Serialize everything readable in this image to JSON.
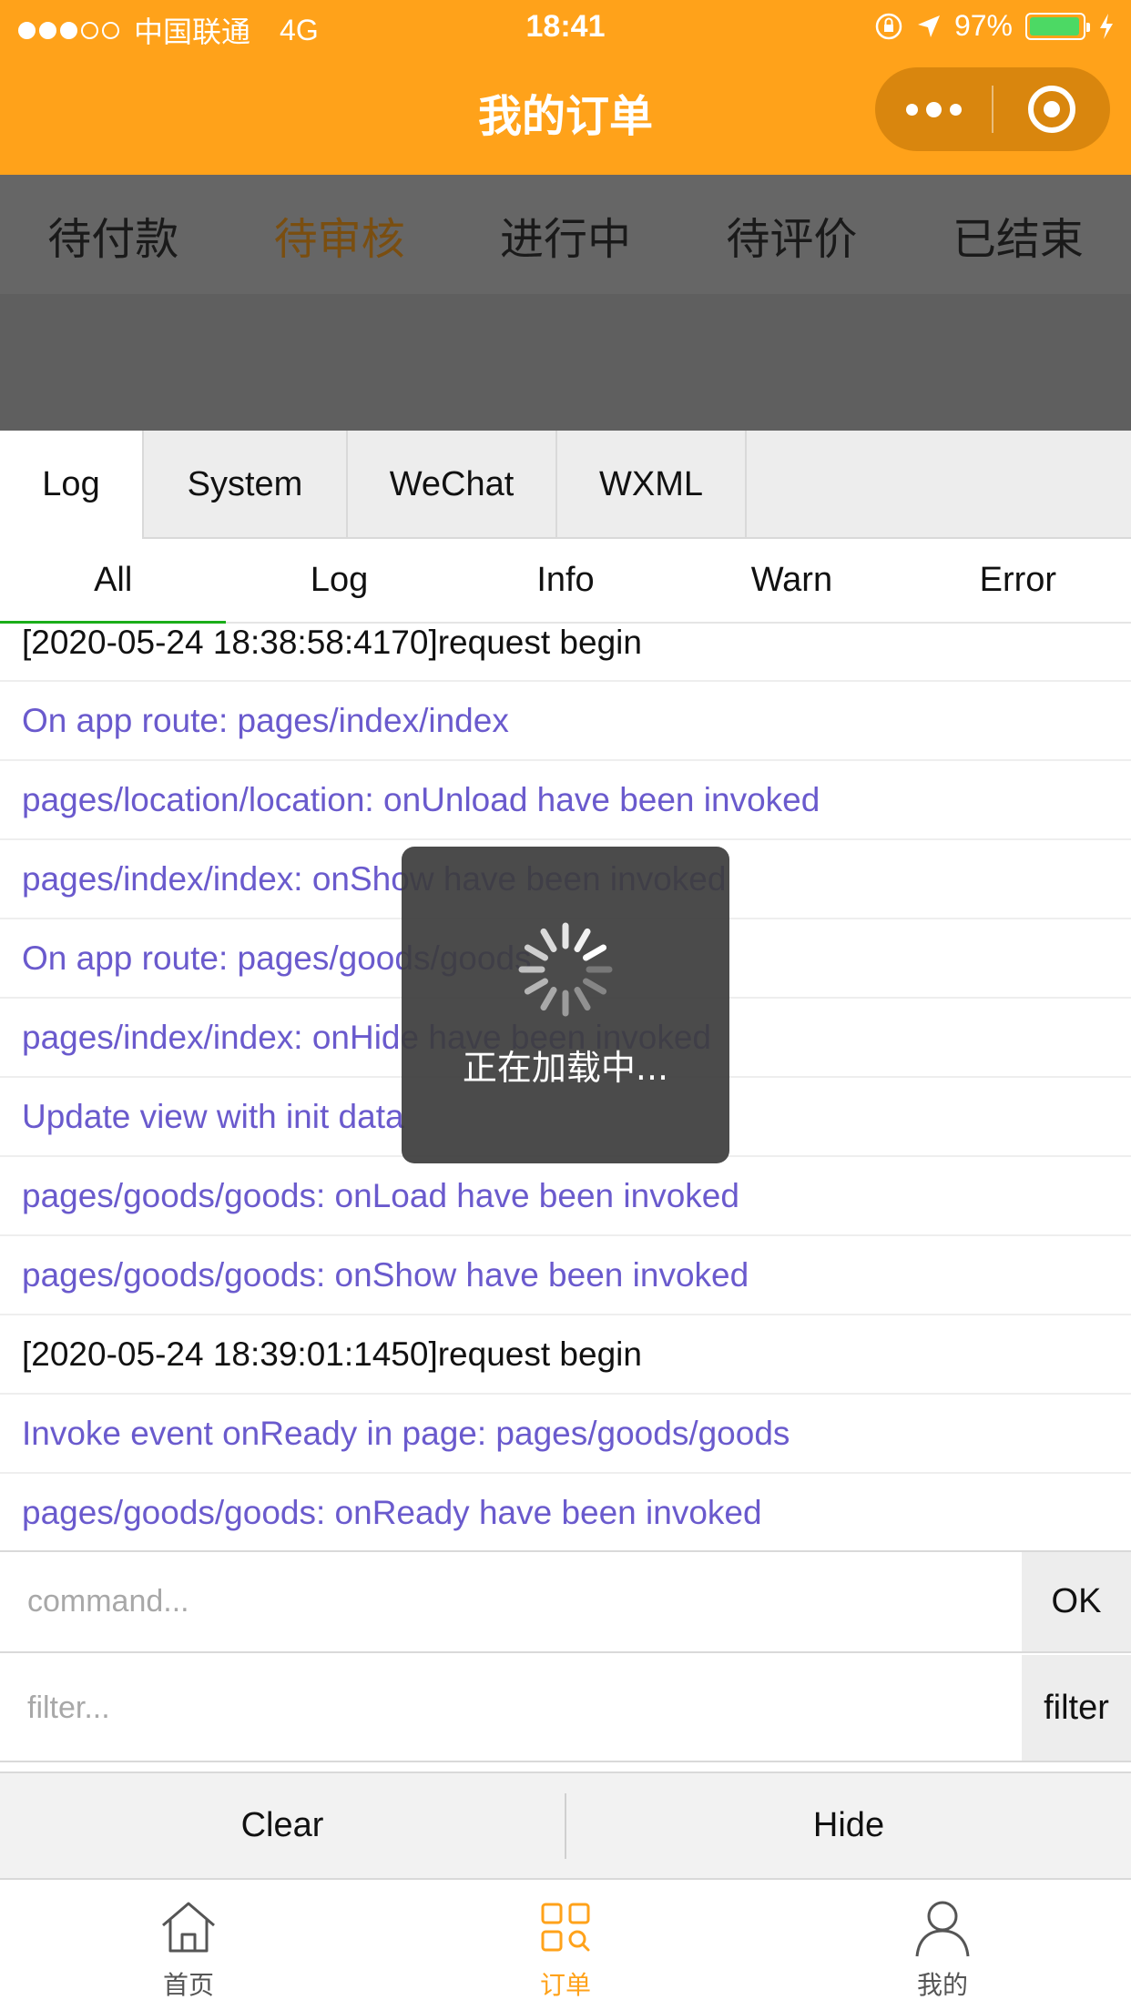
{
  "status_bar": {
    "carrier": "中国联通",
    "network": "4G",
    "time": "18:41",
    "battery": "97%",
    "battery_level": 0.97
  },
  "nav": {
    "title": "我的订单"
  },
  "order_tabs": [
    {
      "label": "待付款",
      "active": false
    },
    {
      "label": "待审核",
      "active": true
    },
    {
      "label": "进行中",
      "active": false
    },
    {
      "label": "待评价",
      "active": false
    },
    {
      "label": "已结束",
      "active": false
    }
  ],
  "vconsole": {
    "tabs": [
      "Log",
      "System",
      "WeChat",
      "WXML"
    ],
    "active_tab": "Log",
    "subtabs": [
      "All",
      "Log",
      "Info",
      "Warn",
      "Error"
    ],
    "active_subtab": "All",
    "logs": [
      {
        "text": "[2020-05-24 18:38:58:4170]request begin",
        "kind": "plain"
      },
      {
        "text": "On app route: pages/index/index",
        "kind": "sys"
      },
      {
        "text": "pages/location/location: onUnload have been invoked",
        "kind": "sys"
      },
      {
        "text": "pages/index/index: onShow have been invoked",
        "kind": "sys"
      },
      {
        "text": "On app route: pages/goods/goods",
        "kind": "sys"
      },
      {
        "text": "pages/index/index: onHide have been invoked",
        "kind": "sys"
      },
      {
        "text": "Update view with init data",
        "kind": "sys"
      },
      {
        "text": "pages/goods/goods: onLoad have been invoked",
        "kind": "sys"
      },
      {
        "text": "pages/goods/goods: onShow have been invoked",
        "kind": "sys"
      },
      {
        "text": "[2020-05-24 18:39:01:1450]request begin",
        "kind": "plain"
      },
      {
        "text": "Invoke event onReady in page: pages/goods/goods",
        "kind": "sys"
      },
      {
        "text": "pages/goods/goods: onReady have been invoked",
        "kind": "sys"
      }
    ],
    "command_placeholder": "command...",
    "ok_label": "OK",
    "filter_placeholder": "filter...",
    "filter_label": "filter",
    "clear_label": "Clear",
    "hide_label": "Hide"
  },
  "toast": {
    "text": "正在加载中..."
  },
  "tabbar": [
    {
      "label": "首页",
      "icon": "home-icon",
      "active": false
    },
    {
      "label": "订单",
      "icon": "orders-grid-icon",
      "active": true
    },
    {
      "label": "我的",
      "icon": "user-icon",
      "active": false
    }
  ],
  "colors": {
    "brand": "#FFA21A",
    "log_system": "#6A5ACD",
    "tab_active_underline": "#1AAD19"
  }
}
